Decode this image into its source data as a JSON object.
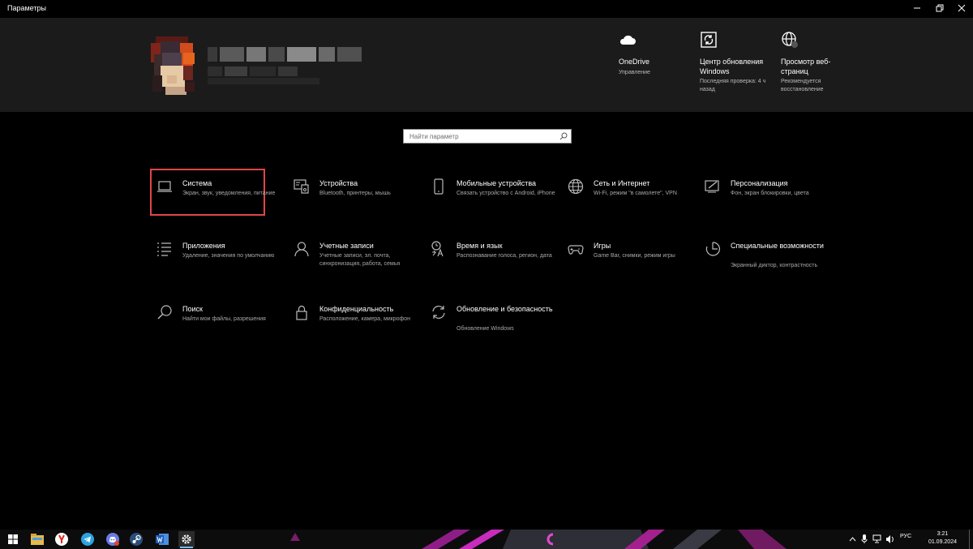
{
  "window": {
    "title": "Параметры"
  },
  "account": {
    "name": "",
    "subtitle": ""
  },
  "quick_links": [
    {
      "title": "OneDrive",
      "subtitle": "Управление",
      "icon": "cloud-icon"
    },
    {
      "title": "Центр обновления Windows",
      "subtitle": "Последняя проверка: 4 ч назад",
      "icon": "sync-icon"
    },
    {
      "title": "Просмотр веб-страниц",
      "subtitle": "Рекомендуется восстановление",
      "icon": "globe-icon"
    }
  ],
  "search": {
    "placeholder": "Найти параметр"
  },
  "categories": [
    {
      "title": "Система",
      "desc": "Экран, звук, уведомления, питание",
      "icon": "laptop-icon",
      "highlighted": true
    },
    {
      "title": "Устройства",
      "desc": "Bluetooth, принтеры, мышь",
      "icon": "devices-icon"
    },
    {
      "title": "Мобильные устройства",
      "desc": "Связать устройство с Android, iPhone",
      "icon": "phone-icon"
    },
    {
      "title": "Сеть и Интернет",
      "desc": "Wi-Fi, режим \"в самолете\", VPN",
      "icon": "globe-icon"
    },
    {
      "title": "Персонализация",
      "desc": "Фон, экран блокировки, цвета",
      "icon": "personalization-icon"
    },
    {
      "title": "Приложения",
      "desc": "Удаление, значения по умолчанию",
      "icon": "apps-list-icon"
    },
    {
      "title": "Учетные записи",
      "desc": "Учетные записи, эл. почта, синхронизация, работа, семья",
      "icon": "person-icon"
    },
    {
      "title": "Время и язык",
      "desc": "Распознавание голоса, регион, дата",
      "icon": "time-language-icon"
    },
    {
      "title": "Игры",
      "desc": "Game Bar, снимки, режим игры",
      "icon": "gamepad-icon"
    },
    {
      "title": "Специальные возможности",
      "desc": "Экранный диктор, контрастность",
      "icon": "accessibility-icon"
    },
    {
      "title": "Поиск",
      "desc": "Найти мои файлы, разрешения",
      "icon": "search-icon"
    },
    {
      "title": "Конфиденциальность",
      "desc": "Расположение, камера, микрофон",
      "icon": "lock-icon"
    },
    {
      "title": "Обновление и безопасность",
      "desc": "Обновление Windows",
      "icon": "update-icon"
    }
  ],
  "taskbar": {
    "apps": [
      "windows-start-icon",
      "file-explorer-icon",
      "yandex-browser-icon",
      "telegram-icon",
      "discord-icon",
      "steam-icon",
      "word-icon",
      "settings-icon"
    ],
    "language": "РУС",
    "time": "3:21",
    "date": "01.09.2024"
  },
  "colors": {
    "highlight": "#e14646",
    "header_bg": "#1b1b1b",
    "background": "#000000"
  }
}
